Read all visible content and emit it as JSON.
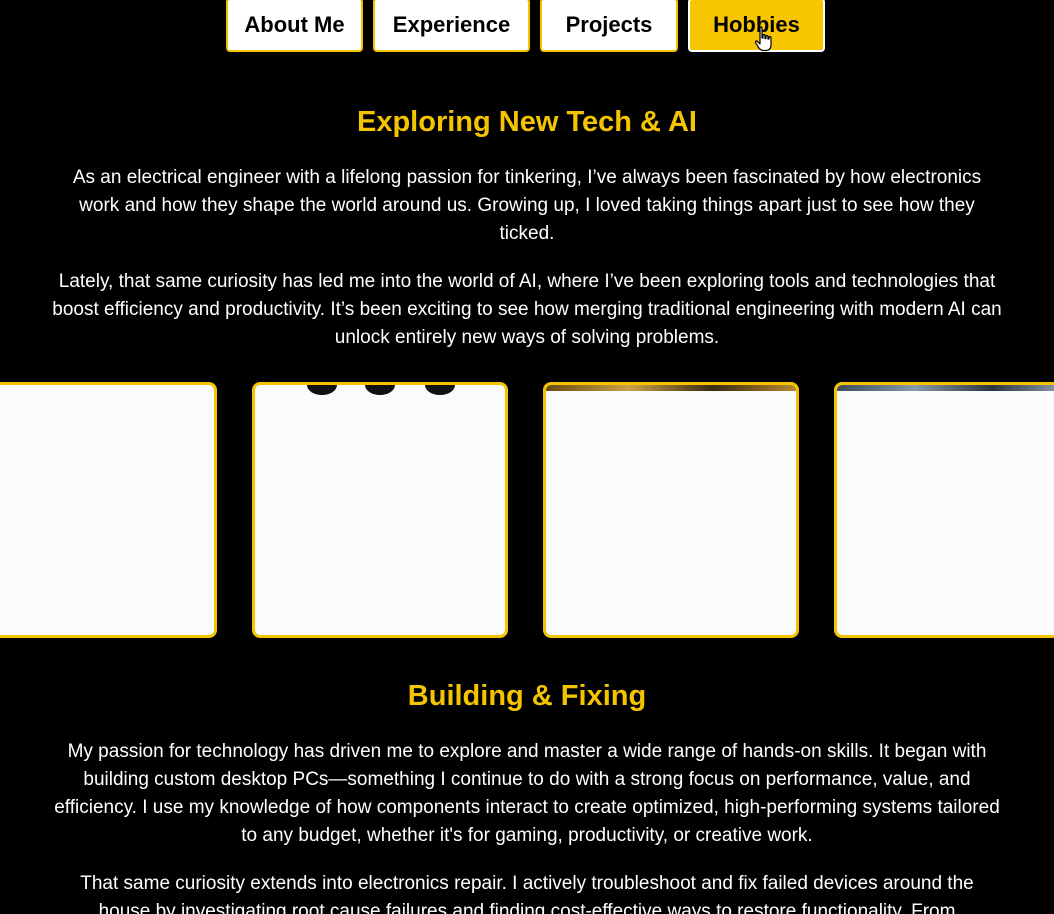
{
  "nav": {
    "items": [
      {
        "label": "About Me",
        "active": false
      },
      {
        "label": "Experience",
        "active": false
      },
      {
        "label": "Projects",
        "active": false
      },
      {
        "label": "Hobbies",
        "active": true
      }
    ],
    "cursor_icon": "hand-pointer-icon"
  },
  "colors": {
    "background": "#000000",
    "accent": "#f5c400",
    "text": "#ffffff",
    "card_background": "#fbfbfb"
  },
  "sections": [
    {
      "title": "Exploring New Tech & AI",
      "paragraphs": [
        "As an electrical engineer with a lifelong passion for tinkering, I’ve always been fascinated by how electronics work and how they shape the world around us. Growing up, I loved taking things apart just to see how they ticked.",
        "Lately, that same curiosity has led me into the world of AI, where I’ve been exploring tools and technologies that boost efficiency and productivity. It’s been exciting to see how merging traditional engineering with modern AI can unlock entirely new ways of solving problems."
      ]
    },
    {
      "title": "Building & Fixing",
      "paragraphs": [
        "My passion for technology has driven me to explore and master a wide range of hands-on skills. It began with building custom desktop PCs—something I continue to do with a strong focus on performance, value, and efficiency. I use my knowledge of how components interact to create optimized, high-performing systems tailored to any budget, whether it's for gaming, productivity, or creative work.",
        "That same curiosity extends into electronics repair. I actively troubleshoot and fix failed devices around the house by investigating root cause failures and finding cost-effective ways to restore functionality. From"
      ]
    }
  ],
  "carousel": {
    "card_count": 4
  }
}
